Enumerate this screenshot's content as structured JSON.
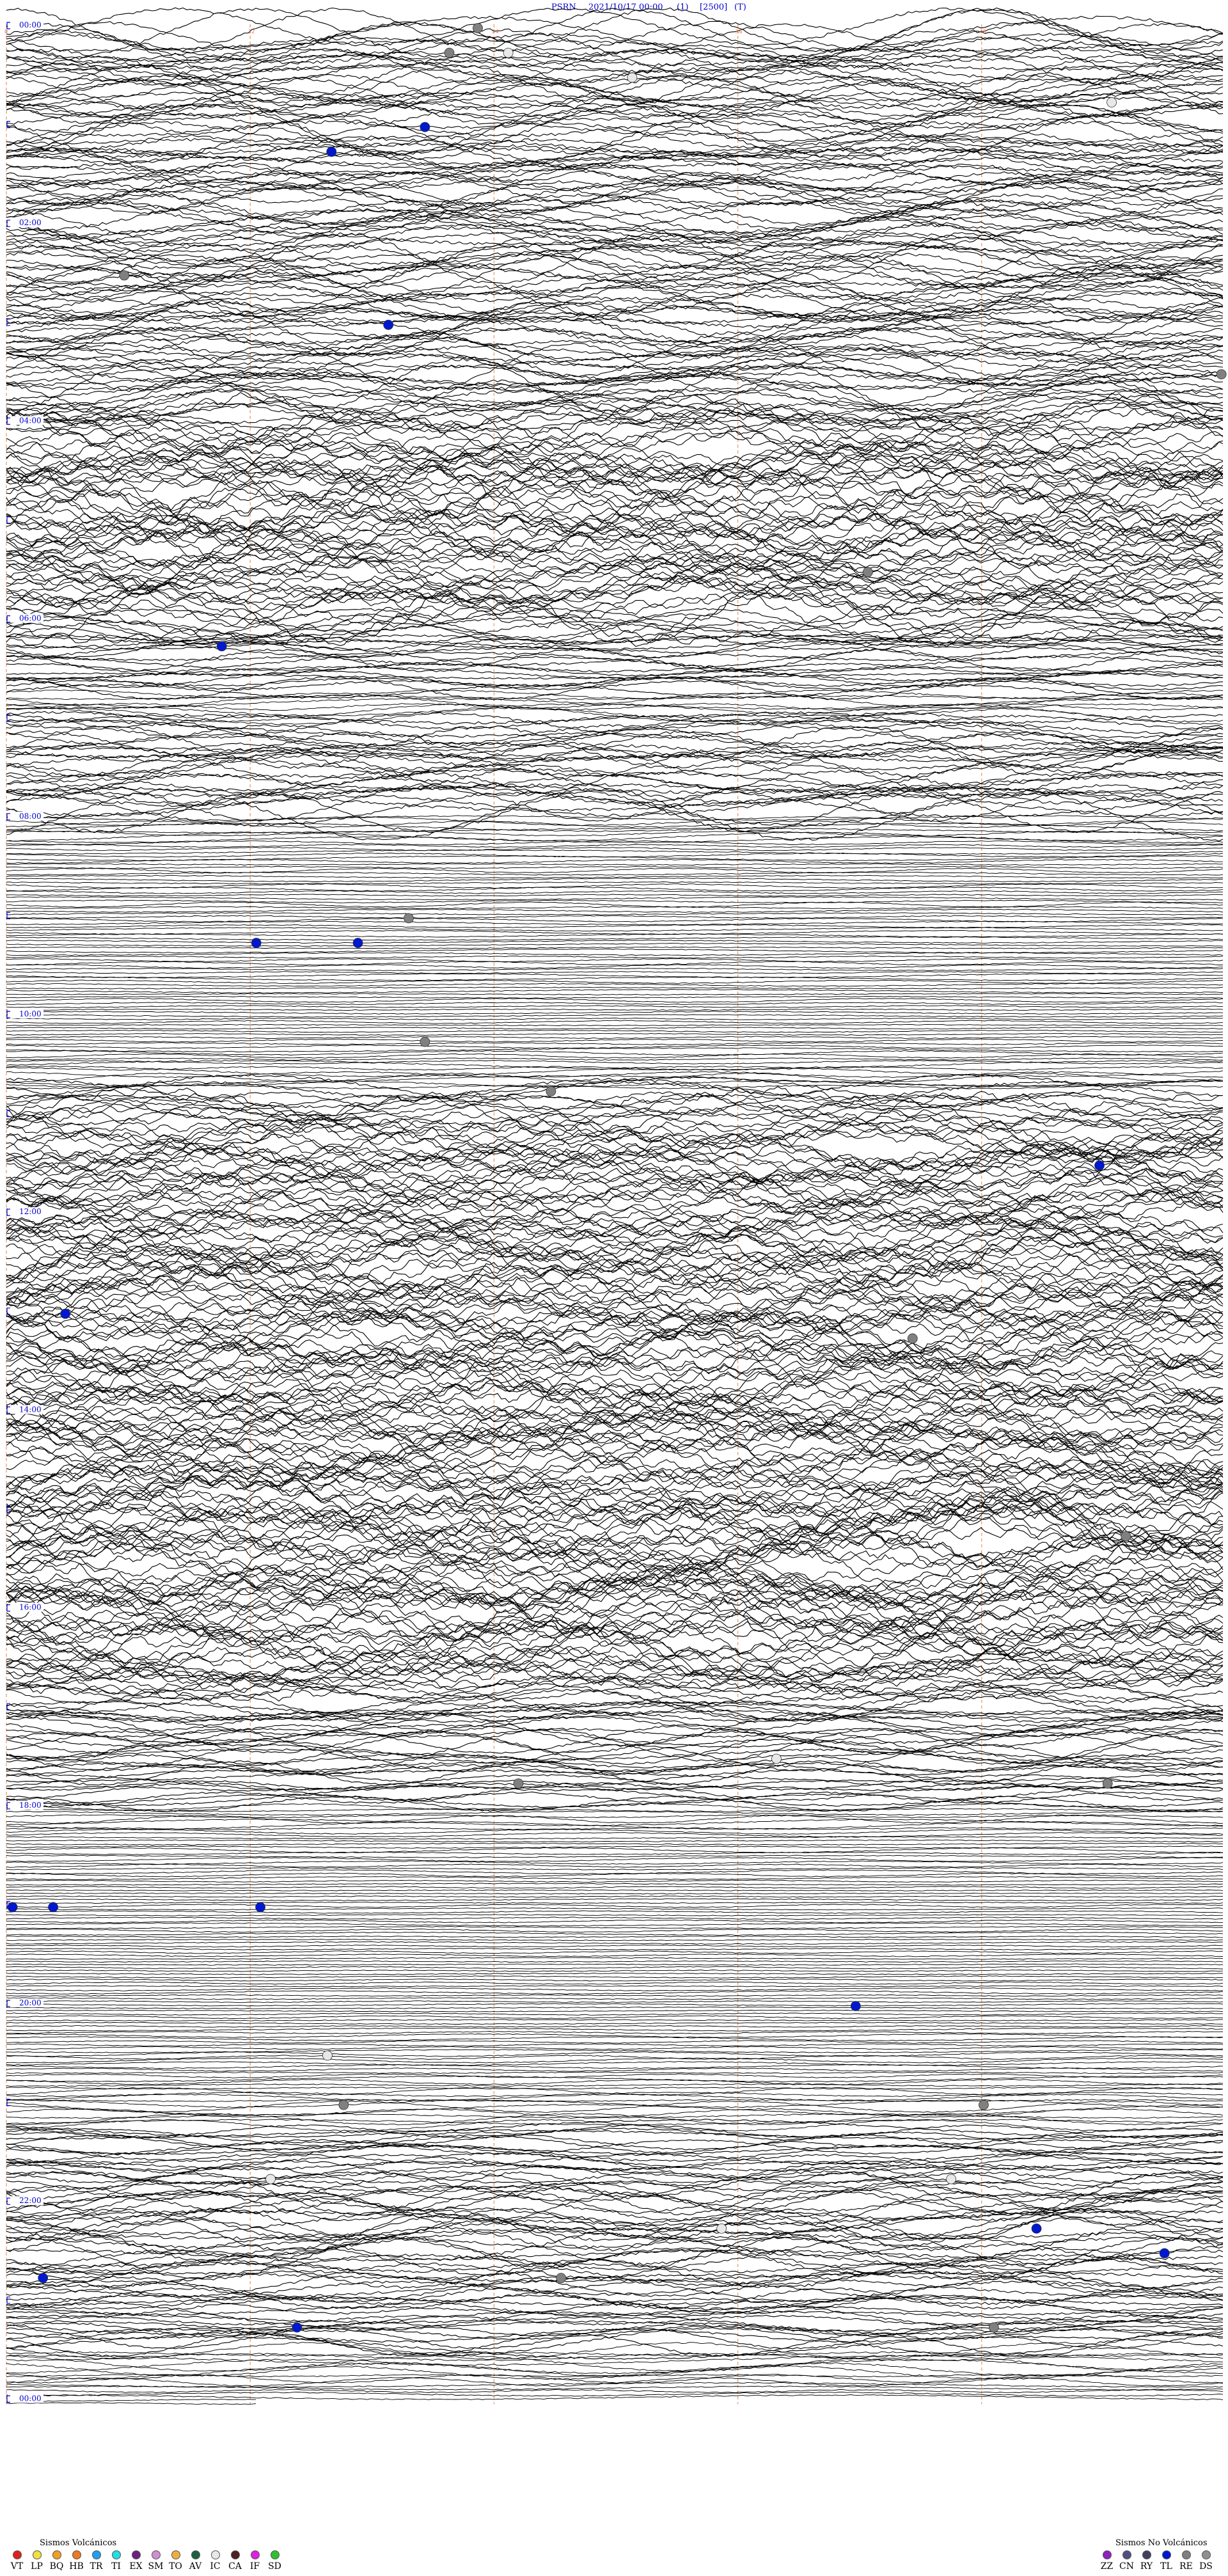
{
  "header": {
    "station": "PSRN",
    "datetime": "2021/10/17 00:00",
    "field1": "(1)",
    "field2": "[2500]",
    "field3": "(T)"
  },
  "chart_data": {
    "type": "line",
    "x_axis": "minutes within hour",
    "xlim": [
      0,
      60
    ],
    "minute_markers": [
      0,
      12,
      24,
      36,
      48
    ],
    "rows_total": 97,
    "hour_labels": [
      {
        "row": 0,
        "text": "00:00"
      },
      {
        "row": 8,
        "text": "02:00"
      },
      {
        "row": 16,
        "text": "04:00"
      },
      {
        "row": 24,
        "text": "06:00"
      },
      {
        "row": 32,
        "text": "08:00"
      },
      {
        "row": 40,
        "text": "10:00"
      },
      {
        "row": 48,
        "text": "12:00"
      },
      {
        "row": 56,
        "text": "14:00"
      },
      {
        "row": 64,
        "text": "16:00"
      },
      {
        "row": 72,
        "text": "18:00"
      },
      {
        "row": 80,
        "text": "20:00"
      },
      {
        "row": 88,
        "text": "22:00"
      },
      {
        "row": 96,
        "text": "00:00"
      }
    ],
    "activity_by_row": [
      0.55,
      0.6,
      0.6,
      0.55,
      0.6,
      0.6,
      0.55,
      0.6,
      0.6,
      0.55,
      0.6,
      0.6,
      0.6,
      0.55,
      0.6,
      0.6,
      0.7,
      0.7,
      0.75,
      0.8,
      0.75,
      0.7,
      0.65,
      0.7,
      0.4,
      0.35,
      0.3,
      0.2,
      0.45,
      0.55,
      0.6,
      0.55,
      0.1,
      0.05,
      0.05,
      0.05,
      0.04,
      0.04,
      0.04,
      0.04,
      0.03,
      0.05,
      0.12,
      0.5,
      0.65,
      0.7,
      0.75,
      0.7,
      0.7,
      0.75,
      0.8,
      0.75,
      0.8,
      0.75,
      0.8,
      0.75,
      0.75,
      0.8,
      0.75,
      0.8,
      0.85,
      0.8,
      0.75,
      0.8,
      0.8,
      0.75,
      0.7,
      0.55,
      0.4,
      0.35,
      0.3,
      0.25,
      0.08,
      0.05,
      0.04,
      0.03,
      0.03,
      0.03,
      0.03,
      0.03,
      0.03,
      0.04,
      0.05,
      0.08,
      0.12,
      0.25,
      0.35,
      0.45,
      0.5,
      0.55,
      0.5,
      0.45,
      0.35,
      0.3,
      0.2,
      0.1,
      0.02
    ],
    "events": [
      {
        "row": 0,
        "minute": 23.2,
        "class": "RE"
      },
      {
        "row": 1,
        "minute": 21.8,
        "class": "RE"
      },
      {
        "row": 1,
        "minute": 24.7,
        "class": "IC"
      },
      {
        "row": 2,
        "minute": 30.8,
        "class": "IC"
      },
      {
        "row": 3,
        "minute": 54.4,
        "class": "IC"
      },
      {
        "row": 4,
        "minute": 20.6,
        "class": "TL"
      },
      {
        "row": 5,
        "minute": 16.0,
        "class": "TL"
      },
      {
        "row": 10,
        "minute": 5.8,
        "class": "RE"
      },
      {
        "row": 12,
        "minute": 18.8,
        "class": "TL"
      },
      {
        "row": 14,
        "minute": 59.8,
        "class": "RE"
      },
      {
        "row": 22,
        "minute": 42.4,
        "class": "RE"
      },
      {
        "row": 25,
        "minute": 10.6,
        "class": "TL"
      },
      {
        "row": 36,
        "minute": 19.8,
        "class": "RE"
      },
      {
        "row": 37,
        "minute": 12.3,
        "class": "TL"
      },
      {
        "row": 37,
        "minute": 17.3,
        "class": "TL"
      },
      {
        "row": 41,
        "minute": 20.6,
        "class": "RE"
      },
      {
        "row": 43,
        "minute": 26.8,
        "class": "RE"
      },
      {
        "row": 46,
        "minute": 53.8,
        "class": "TL"
      },
      {
        "row": 52,
        "minute": 2.9,
        "class": "TL"
      },
      {
        "row": 53,
        "minute": 44.6,
        "class": "RE"
      },
      {
        "row": 61,
        "minute": 55.1,
        "class": "RE"
      },
      {
        "row": 70,
        "minute": 37.9,
        "class": "IC"
      },
      {
        "row": 71,
        "minute": 25.2,
        "class": "RE"
      },
      {
        "row": 71,
        "minute": 54.2,
        "class": "RE"
      },
      {
        "row": 76,
        "minute": 0.3,
        "class": "TL"
      },
      {
        "row": 76,
        "minute": 2.3,
        "class": "TL"
      },
      {
        "row": 76,
        "minute": 12.5,
        "class": "TL"
      },
      {
        "row": 80,
        "minute": 41.8,
        "class": "TL"
      },
      {
        "row": 82,
        "minute": 15.8,
        "class": "IC"
      },
      {
        "row": 84,
        "minute": 16.6,
        "class": "RE"
      },
      {
        "row": 84,
        "minute": 48.1,
        "class": "RE"
      },
      {
        "row": 87,
        "minute": 13.0,
        "class": "IC"
      },
      {
        "row": 87,
        "minute": 46.5,
        "class": "IC"
      },
      {
        "row": 89,
        "minute": 35.2,
        "class": "IC"
      },
      {
        "row": 89,
        "minute": 50.7,
        "class": "TL"
      },
      {
        "row": 90,
        "minute": 57.0,
        "class": "TL"
      },
      {
        "row": 91,
        "minute": 1.8,
        "class": "TL"
      },
      {
        "row": 91,
        "minute": 27.3,
        "class": "RE"
      },
      {
        "row": 93,
        "minute": 14.3,
        "class": "TL"
      },
      {
        "row": 93,
        "minute": 48.6,
        "class": "RE"
      }
    ]
  },
  "legend": {
    "volcanic_title": "Sismos Volcánicos",
    "volcanic": [
      {
        "code": "VT",
        "color": "#e02020"
      },
      {
        "code": "LP",
        "color": "#f0e040"
      },
      {
        "code": "BQ",
        "color": "#f0a020"
      },
      {
        "code": "HB",
        "color": "#f07820"
      },
      {
        "code": "TR",
        "color": "#20a0f0"
      },
      {
        "code": "TI",
        "color": "#20e0e0"
      },
      {
        "code": "EX",
        "color": "#702080"
      },
      {
        "code": "SM",
        "color": "#d090d0"
      },
      {
        "code": "TO",
        "color": "#f0b040"
      },
      {
        "code": "AV",
        "color": "#206040"
      },
      {
        "code": "IC",
        "color": "#e8e8e8"
      },
      {
        "code": "CA",
        "color": "#502020"
      },
      {
        "code": "IF",
        "color": "#e020e0"
      },
      {
        "code": "SD",
        "color": "#30c030"
      }
    ],
    "non_volcanic_title": "Sismos No Volcánicos",
    "non_volcanic": [
      {
        "code": "ZZ",
        "color": "#9020c0"
      },
      {
        "code": "CN",
        "color": "#505080"
      },
      {
        "code": "RY",
        "color": "#404060"
      },
      {
        "code": "TL",
        "color": "#0018d0"
      },
      {
        "code": "RE",
        "color": "#808080"
      },
      {
        "code": "DS",
        "color": "#909090"
      }
    ]
  },
  "colors": {
    "trace": "#000000",
    "marker_line": "#e8a070",
    "marker_text": "#e07040",
    "hour_label": "#0000cc"
  }
}
